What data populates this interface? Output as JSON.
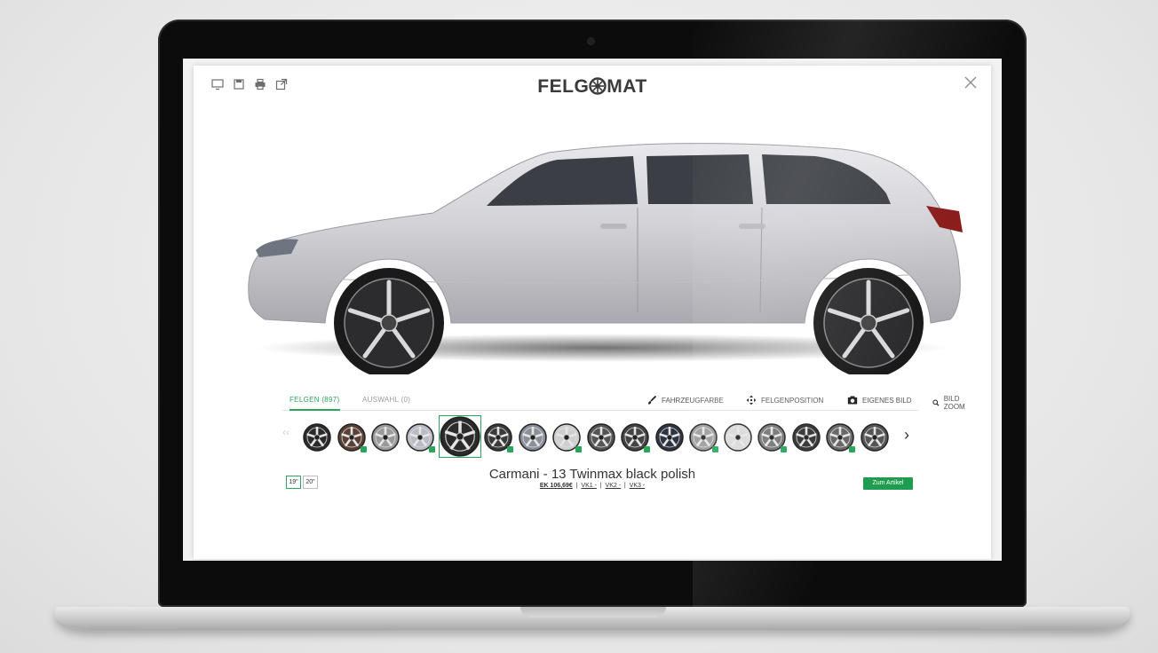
{
  "app": {
    "brand": "FELG",
    "brand_suffix": "MAT"
  },
  "colors": {
    "accent": "#2aa55a",
    "cta": "#1f9c4f",
    "car_body": "#cfcfd4"
  },
  "toolbar": {
    "icons": [
      "monitor-icon",
      "save-icon",
      "print-icon",
      "external-link-icon"
    ]
  },
  "tabs": {
    "felgen": "FELGEN (897)",
    "auswahl": "AUSWAHL (0)"
  },
  "tools": {
    "fahrzeugfarbe": "FAHRZEUGFARBE",
    "felgenposition": "FELGENPOSITION",
    "eigenes_bild": "EIGENES BILD",
    "bild_zoom": "BILD ZOOM"
  },
  "product": {
    "name": "Carmani - 13 Twinmax black polish",
    "ek_price": "EK 106,69€",
    "vk1": "VK1 -",
    "vk2": "VK2 -",
    "vk3": "VK3 -",
    "cta_label": "Zum Artikel"
  },
  "sizes": [
    "19\"",
    "20\""
  ],
  "navigation": {
    "prev": "‹‹",
    "next": "›"
  }
}
